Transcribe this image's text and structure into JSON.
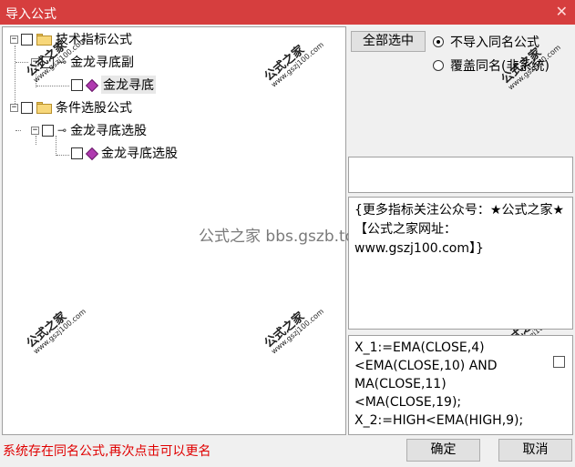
{
  "window": {
    "title": "导入公式",
    "close_icon": "close-icon"
  },
  "tree": {
    "items": [
      {
        "label": "技术指标公式",
        "icon": "folder-icon",
        "expander": "−"
      },
      {
        "label": "金龙寻底副",
        "icon": "key-icon",
        "expander": "−"
      },
      {
        "label": "金龙寻底",
        "icon": "gem-icon",
        "expander": ""
      },
      {
        "label": "条件选股公式",
        "icon": "folder-icon",
        "expander": "−"
      },
      {
        "label": "金龙寻底选股",
        "icon": "key-icon",
        "expander": "−"
      },
      {
        "label": "金龙寻底选股",
        "icon": "gem-icon",
        "expander": ""
      }
    ]
  },
  "overlay_text": "公式之家 bbs.gszb.top",
  "watermark": {
    "main": "公式之家",
    "sub": "www.gszj100.com"
  },
  "select_all_button": "全部选中",
  "import_options": {
    "selected": "不导入同名公式",
    "options": [
      "不导入同名公式",
      "覆盖同名(非系统)"
    ]
  },
  "description": "{更多指标关注公众号：★公式之家★ 【公式之家网址：www.gszj100.com】}",
  "formula_preview": "X_1:=EMA(CLOSE,4)<EMA(CLOSE,10) AND MA(CLOSE,11)<MA(CLOSE,19);\nX_2:=HIGH<EMA(HIGH,9);",
  "status_message": "系统存在同名公式,再次点击可以更名",
  "ok_button": "确定",
  "cancel_button": "取消"
}
